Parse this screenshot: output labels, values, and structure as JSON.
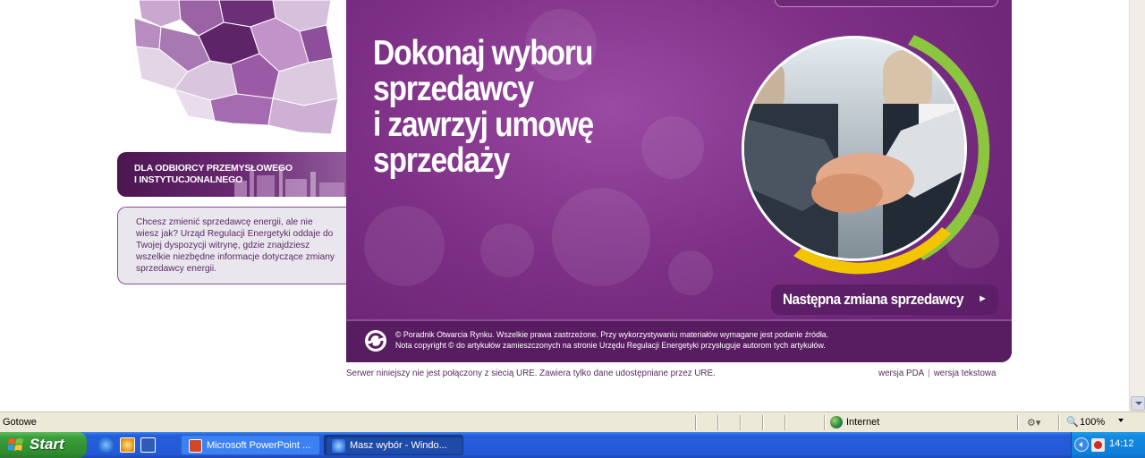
{
  "sidebar": {
    "industrial_banner_label": "DLA ODBIORCY PRZEMYSŁOWEGO\nI INSTYTUCJONALNEGO",
    "info_text": "Chcesz zmienić sprzedawcę energii, ale nie wiesz jak? Urząd Regulacji Energetyki oddaje do Twojej dyspozycji witrynę, gdzie znajdziesz wszelkie niezbędne informacje dotyczące zmiany sprzedawcy energii."
  },
  "hero": {
    "title": "Dokonaj wyboru\nsprzedawcy\ni zawrzyj umowę\nsprzedaży",
    "next_button_label": "Następna zmiana sprzedawcy",
    "next_button_arrow": "►",
    "footer_text": "© Poradnik Otwarcia Rynku. Wszelkie prawa zastrzeżone. Przy wykorzystywaniu materiałów wymagane jest podanie źródła.\nNota copyright © do artykułów zamieszczonych na stronie Urzędu Regulacji Energetyki przysługuje autorom tych artykułów."
  },
  "page_footer": {
    "server_note": "Serwer niniejszy nie jest połączony z siecią URE. Zawiera tylko dane udostępniane przez URE.",
    "link_pda": "wersja PDA",
    "separator": "|",
    "link_text": "wersja tekstowa"
  },
  "statusbar": {
    "status": "Gotowe",
    "zone": "Internet",
    "zoom": "100%"
  },
  "taskbar": {
    "start_label": "Start",
    "tasks": [
      {
        "label": "Microsoft PowerPoint ...",
        "icon": "powerpoint-icon"
      },
      {
        "label": "Masz wybór - Windo...",
        "icon": "internet-explorer-icon"
      }
    ],
    "clock": "14:12"
  },
  "colors": {
    "brand_purple": "#7d2f86",
    "brand_dark": "#581d61",
    "accent_green": "#8cc63f",
    "accent_yellow": "#f2c500"
  }
}
